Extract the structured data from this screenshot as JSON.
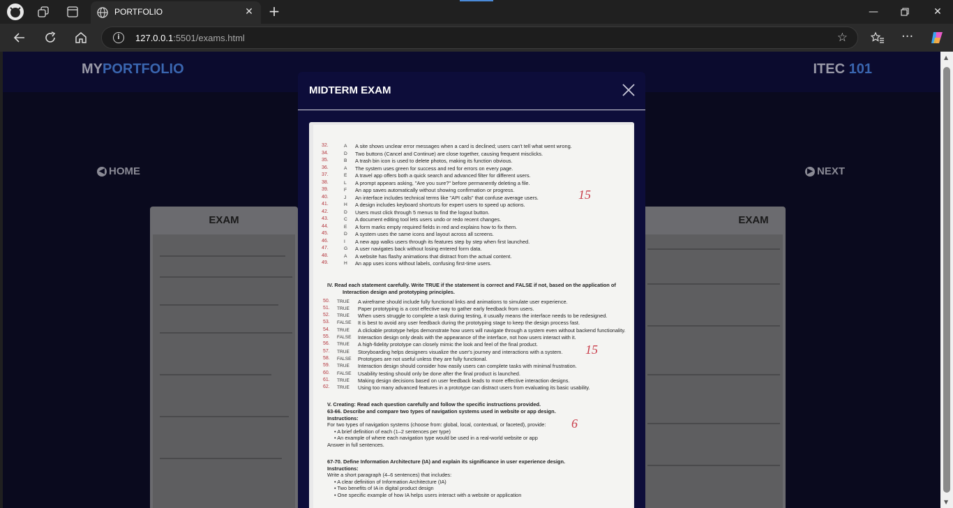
{
  "browser": {
    "tab_title": "PORTFOLIO",
    "url_host": "127.0.0.1",
    "url_path": ":5501/exams.html"
  },
  "site": {
    "logo_prefix": "MY",
    "logo_accent": "PORTFOLIO",
    "course_prefix": "ITEC ",
    "course_accent": "101",
    "nav_home": "HOME",
    "nav_next": "NEXT",
    "card_left_title": "EXAM",
    "card_right_title": "EXAM"
  },
  "modal": {
    "title": "MIDTERM EXAM"
  },
  "exam": {
    "part3_items": [
      {
        "num": "32.",
        "ans": "A",
        "text": "A site shows unclear error messages when a card is declined; users can't tell what went wrong."
      },
      {
        "num": "34.",
        "ans": "D",
        "text": "Two buttons (Cancel and Continue) are close together, causing frequent misclicks."
      },
      {
        "num": "35.",
        "ans": "B",
        "text": "A trash bin icon is used to delete photos, making its function obvious."
      },
      {
        "num": "36.",
        "ans": "A",
        "text": "The system uses green for success and red for errors on every page."
      },
      {
        "num": "37.",
        "ans": "E",
        "text": "A travel app offers both a quick search and advanced filter for different users."
      },
      {
        "num": "38.",
        "ans": "L",
        "text": "A prompt appears asking, \"Are you sure?\" before permanently deleting a file."
      },
      {
        "num": "39.",
        "ans": "F",
        "text": "An app saves automatically without showing confirmation or progress."
      },
      {
        "num": "40.",
        "ans": "J",
        "text": "An interface includes technical terms like \"API calls\" that confuse average users."
      },
      {
        "num": "41.",
        "ans": "H",
        "text": "A design includes keyboard shortcuts for expert users to speed up actions."
      },
      {
        "num": "42.",
        "ans": "D",
        "text": "Users must click through 5 menus to find the logout button."
      },
      {
        "num": "43.",
        "ans": "C",
        "text": "A document editing tool lets users undo or redo recent changes."
      },
      {
        "num": "44.",
        "ans": "E",
        "text": "A form marks empty required fields in red and explains how to fix them."
      },
      {
        "num": "45.",
        "ans": "D",
        "text": "A system uses the same icons and layout across all screens."
      },
      {
        "num": "46.",
        "ans": "I",
        "text": "A new app walks users through its features step by step when first launched."
      },
      {
        "num": "47.",
        "ans": "G",
        "text": "A user navigates back without losing entered form data."
      },
      {
        "num": "48.",
        "ans": "A",
        "text": "A website has flashy animations that distract from the actual content."
      },
      {
        "num": "49.",
        "ans": "H",
        "text": "An app uses icons without labels, confusing first-time users."
      }
    ],
    "part4_heading": "IV.    Read each statement carefully. Write TRUE if the statement is correct and FALSE if not, based on the application of",
    "part4_heading2": "Interaction design and prototyping principles.",
    "part4_items": [
      {
        "num": "50.",
        "ans": "TRUE",
        "text": "A wireframe should include fully functional links and animations to simulate user experience."
      },
      {
        "num": "51.",
        "ans": "TRUE",
        "text": "Paper prototyping is a cost effective way to gather early feedback from users."
      },
      {
        "num": "52.",
        "ans": "TRUE",
        "text": "When users struggle to complete a task during testing, it usually means the interface needs to be redesigned."
      },
      {
        "num": "53.",
        "ans": "FALSE",
        "text": "It is best to avoid any user feedback during the prototyping stage to keep the design process fast."
      },
      {
        "num": "54.",
        "ans": "TRUE",
        "text": "A clickable prototype helps demonstrate how users will navigate through a system even without backend functionality."
      },
      {
        "num": "55.",
        "ans": "FALSE",
        "text": "Interaction design only deals with the appearance of the interface, not how users interact with it."
      },
      {
        "num": "56.",
        "ans": "TRUE",
        "text": "A high-fidelity prototype can closely mimic the look and feel of the final product."
      },
      {
        "num": "57.",
        "ans": "TRUE",
        "text": "Storyboarding helps designers visualize the user's journey and interactions with a system."
      },
      {
        "num": "58.",
        "ans": "FALSE",
        "text": "Prototypes are not useful unless they are fully functional."
      },
      {
        "num": "59.",
        "ans": "TRUE",
        "text": "Interaction design should consider how easily users can complete tasks with minimal frustration."
      },
      {
        "num": "60.",
        "ans": "FALSE",
        "text": "Usability testing should only be done after the final product is launched."
      },
      {
        "num": "61.",
        "ans": "TRUE",
        "text": "Making design decisions based on user feedback leads to more effective interaction designs."
      },
      {
        "num": "62.",
        "ans": "TRUE",
        "text": "Using too many advanced features in a prototype can distract users from evaluating its basic usability."
      }
    ],
    "part5_lines": [
      "V.     Creating: Read each question carefully and follow the specific instructions provided.",
      "63-66.  Describe and compare two types of navigation systems used in website or app design.",
      "Instructions:",
      "For two types of navigation systems (choose from: global, local, contextual, or faceted), provide:",
      "•   A brief definition of each (1–2 sentences per type)",
      "•   An example of where each navigation type would be used in a real-world website or app",
      "     Answer in full sentences.",
      "67-70.  Define Information Architecture (IA) and explain its significance in user experience design.",
      "Instructions:",
      "Write a short paragraph (4–6 sentences) that includes:",
      "•   A clear definition of Information Architecture (IA)",
      "•   Two benefits of IA in digital product design",
      "•   One specific example of how IA helps users interact with a website or application"
    ],
    "scores": [
      "15",
      "15",
      "6"
    ]
  }
}
